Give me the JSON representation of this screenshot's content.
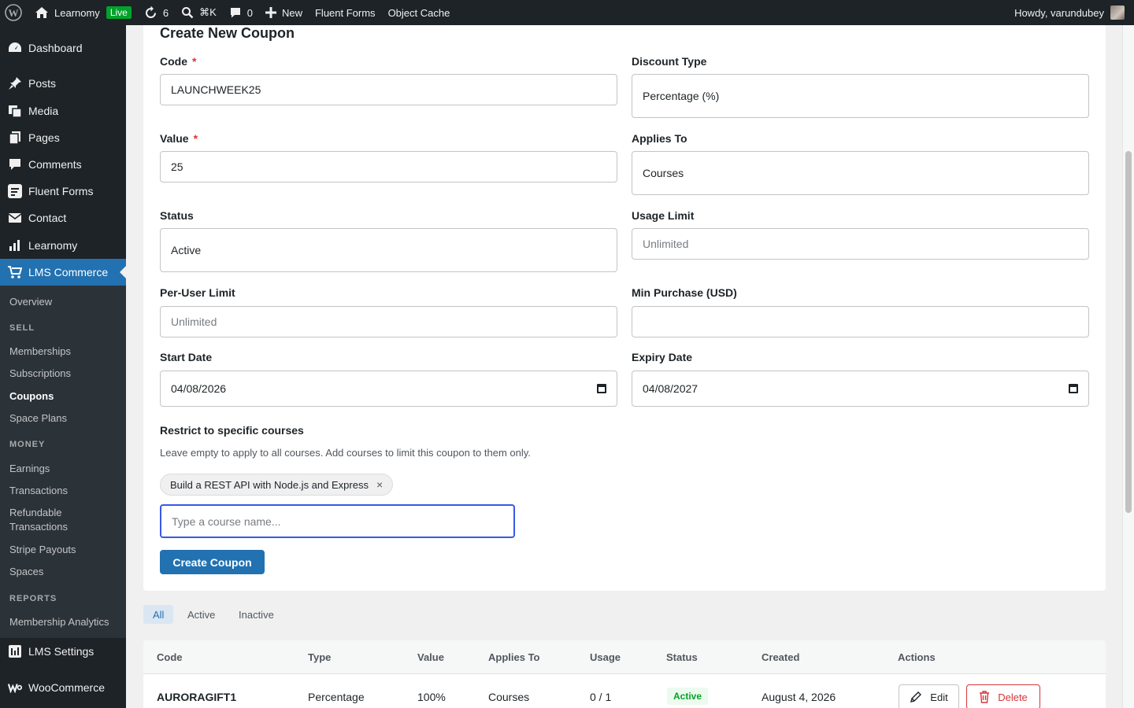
{
  "admin_bar": {
    "site_name": "Learnomy",
    "live_badge": "Live",
    "updates_count": "6",
    "search_shortcut": "⌘K",
    "comments_count": "0",
    "new_label": "New",
    "fluent_forms": "Fluent Forms",
    "object_cache": "Object Cache",
    "howdy": "Howdy, varundubey"
  },
  "sidebar": {
    "items": [
      {
        "label": "Dashboard",
        "icon": "dashboard-icon"
      },
      {
        "label": "Posts",
        "icon": "pin-icon"
      },
      {
        "label": "Media",
        "icon": "media-icon"
      },
      {
        "label": "Pages",
        "icon": "pages-icon"
      },
      {
        "label": "Comments",
        "icon": "comment-icon"
      },
      {
        "label": "Fluent Forms",
        "icon": "forms-icon"
      },
      {
        "label": "Contact",
        "icon": "envelope-icon"
      },
      {
        "label": "Learnomy",
        "icon": "chart-icon"
      },
      {
        "label": "LMS Commerce",
        "icon": "cart-icon"
      },
      {
        "label": "LMS Settings",
        "icon": "settings-icon"
      },
      {
        "label": "WooCommerce",
        "icon": "woo-icon"
      }
    ],
    "submenu": {
      "overview": "Overview",
      "sell_heading": "SELL",
      "memberships": "Memberships",
      "subscriptions": "Subscriptions",
      "coupons": "Coupons",
      "space_plans": "Space Plans",
      "money_heading": "MONEY",
      "earnings": "Earnings",
      "transactions": "Transactions",
      "refundable_1": "Refundable",
      "refundable_2": "Transactions",
      "stripe_payouts": "Stripe Payouts",
      "spaces": "Spaces",
      "reports_heading": "REPORTS",
      "membership_analytics": "Membership Analytics"
    }
  },
  "form": {
    "title": "Create New Coupon",
    "code_label": "Code",
    "code_value": "LAUNCHWEEK25",
    "discount_type_label": "Discount Type",
    "discount_type_value": "Percentage (%)",
    "value_label": "Value",
    "value_value": "25",
    "applies_to_label": "Applies To",
    "applies_to_value": "Courses",
    "status_label": "Status",
    "status_value": "Active",
    "usage_limit_label": "Usage Limit",
    "usage_limit_placeholder": "Unlimited",
    "per_user_label": "Per-User Limit",
    "per_user_placeholder": "Unlimited",
    "min_purchase_label": "Min Purchase (USD)",
    "min_purchase_value": "",
    "start_date_label": "Start Date",
    "start_date_value": "04/08/2026",
    "expiry_date_label": "Expiry Date",
    "expiry_date_value": "04/08/2027",
    "required_mark": "*",
    "restrict_label": "Restrict to specific courses",
    "restrict_help": "Leave empty to apply to all courses. Add courses to limit this coupon to them only.",
    "selected_course": "Build a REST API with Node.js and Express",
    "chip_remove": "×",
    "course_search_placeholder": "Type a course name...",
    "submit_label": "Create Coupon"
  },
  "filters": {
    "tabs": [
      "All",
      "Active",
      "Inactive"
    ],
    "active_tab": "All"
  },
  "table": {
    "headers": [
      "Code",
      "Type",
      "Value",
      "Applies To",
      "Usage",
      "Status",
      "Created",
      "Actions"
    ],
    "rows": [
      {
        "code": "AURORAGIFT1",
        "type": "Percentage",
        "value": "100%",
        "applies_to": "Courses",
        "usage": "0 / 1",
        "status": "Active",
        "created": "August 4, 2026",
        "edit_label": "Edit",
        "delete_label": "Delete"
      }
    ]
  },
  "colors": {
    "admin_bg": "#1d2327",
    "accent": "#2271b1",
    "focus": "#3858e9",
    "danger": "#d63638",
    "success": "#00a32a"
  }
}
